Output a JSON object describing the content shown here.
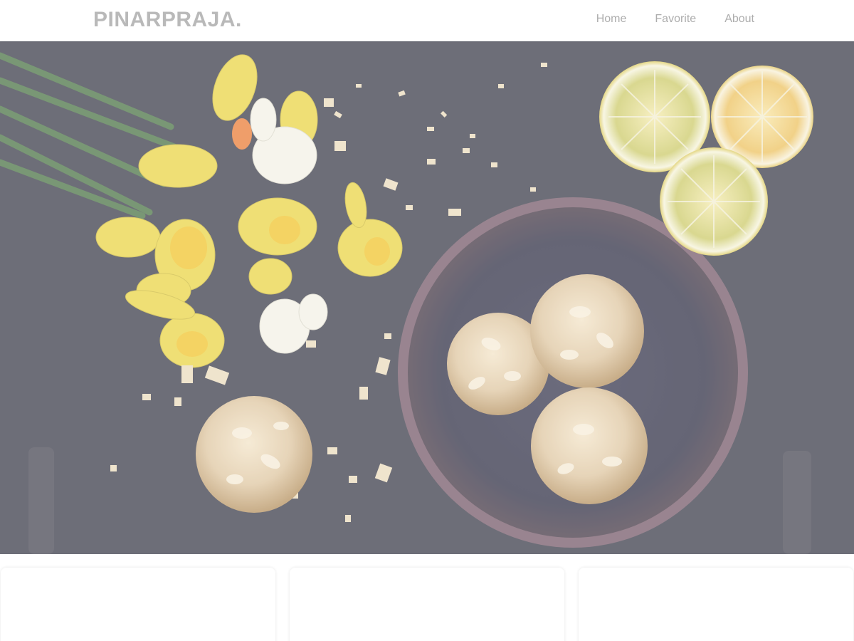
{
  "site": {
    "brand": "PINARPRAJA.",
    "nav": [
      "Home",
      "Favorite",
      "About"
    ]
  },
  "hero": {
    "image_subject": "flat-lay photo: yellow daffodils, almond cookies in a dark bowl, lemon slices on a dark slate table",
    "overlay_color": "#ffffff"
  },
  "cards": {
    "count": 3
  },
  "colors": {
    "brand_text": "#b9b9b9",
    "nav_text": "#adadad",
    "background": "#ffffff",
    "table": "#2d2e3b"
  }
}
